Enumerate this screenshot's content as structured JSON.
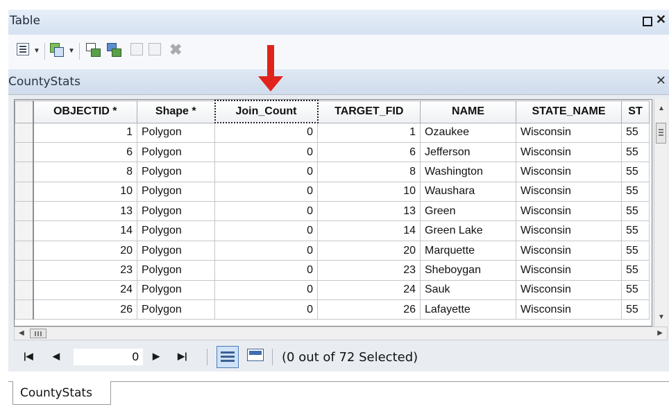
{
  "window": {
    "title": "Table"
  },
  "tab": {
    "name": "CountyStats"
  },
  "columns": [
    "",
    "OBJECTID *",
    "Shape *",
    "Join_Count",
    "TARGET_FID",
    "NAME",
    "STATE_NAME",
    "ST"
  ],
  "rows": [
    [
      "1",
      "Polygon",
      "0",
      "1",
      "Ozaukee",
      "Wisconsin",
      "55"
    ],
    [
      "6",
      "Polygon",
      "0",
      "6",
      "Jefferson",
      "Wisconsin",
      "55"
    ],
    [
      "8",
      "Polygon",
      "0",
      "8",
      "Washington",
      "Wisconsin",
      "55"
    ],
    [
      "10",
      "Polygon",
      "0",
      "10",
      "Waushara",
      "Wisconsin",
      "55"
    ],
    [
      "13",
      "Polygon",
      "0",
      "13",
      "Green",
      "Wisconsin",
      "55"
    ],
    [
      "14",
      "Polygon",
      "0",
      "14",
      "Green Lake",
      "Wisconsin",
      "55"
    ],
    [
      "20",
      "Polygon",
      "0",
      "20",
      "Marquette",
      "Wisconsin",
      "55"
    ],
    [
      "23",
      "Polygon",
      "0",
      "23",
      "Sheboygan",
      "Wisconsin",
      "55"
    ],
    [
      "24",
      "Polygon",
      "0",
      "24",
      "Sauk",
      "Wisconsin",
      "55"
    ],
    [
      "26",
      "Polygon",
      "0",
      "26",
      "Lafayette",
      "Wisconsin",
      "55"
    ]
  ],
  "navigation": {
    "record": "0",
    "first_icon": "first-record-icon",
    "prev_icon": "previous-record-icon",
    "next_icon": "next-record-icon",
    "last_icon": "last-record-icon",
    "selection_status": "(0 out of 72 Selected)"
  },
  "bottom_tab": {
    "label": "CountyStats"
  },
  "colors": {
    "highlight_arrow": "#e0241b",
    "titlebar": "#d5e1f1"
  }
}
